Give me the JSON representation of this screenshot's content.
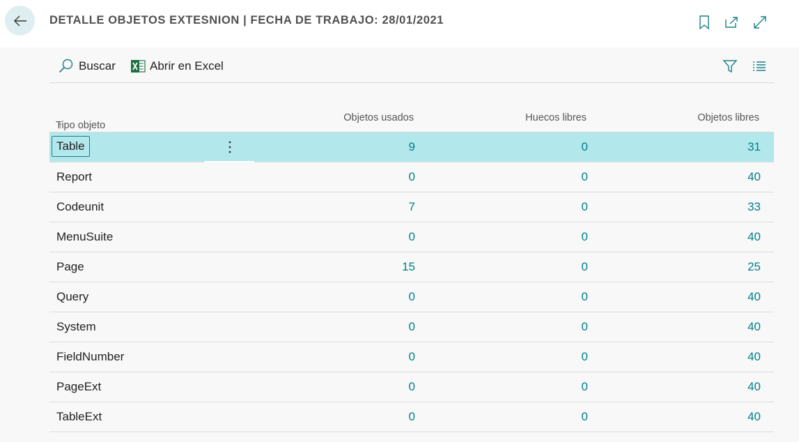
{
  "header": {
    "title": "DETALLE OBJETOS EXTESNION | FECHA DE TRABAJO: 28/01/2021",
    "icons": [
      "arrow-left-icon",
      "bookmark-icon",
      "open-new-window-icon",
      "expand-icon"
    ]
  },
  "toolbar": {
    "search_label": "Buscar",
    "excel_label": "Abrir en Excel",
    "icons": [
      "search-icon",
      "excel-icon",
      "filter-icon",
      "list-view-icon"
    ]
  },
  "grid": {
    "columns": {
      "type": "Tipo objeto",
      "type_sort": "↑",
      "used": "Objetos usados",
      "gaps": "Huecos libres",
      "free": "Objetos libres"
    },
    "rows": [
      {
        "type": "Table",
        "used": "9",
        "gaps": "0",
        "free": "31"
      },
      {
        "type": "Report",
        "used": "0",
        "gaps": "0",
        "free": "40"
      },
      {
        "type": "Codeunit",
        "used": "7",
        "gaps": "0",
        "free": "33"
      },
      {
        "type": "MenuSuite",
        "used": "0",
        "gaps": "0",
        "free": "40"
      },
      {
        "type": "Page",
        "used": "15",
        "gaps": "0",
        "free": "25"
      },
      {
        "type": "Query",
        "used": "0",
        "gaps": "0",
        "free": "40"
      },
      {
        "type": "System",
        "used": "0",
        "gaps": "0",
        "free": "40"
      },
      {
        "type": "FieldNumber",
        "used": "0",
        "gaps": "0",
        "free": "40"
      },
      {
        "type": "PageExt",
        "used": "0",
        "gaps": "0",
        "free": "40"
      },
      {
        "type": "TableExt",
        "used": "0",
        "gaps": "0",
        "free": "40"
      }
    ],
    "selected_row": 0
  },
  "colors": {
    "accent": "#00808a",
    "selected_row": "#b2e8ec",
    "excel_green": "#1d7044"
  }
}
